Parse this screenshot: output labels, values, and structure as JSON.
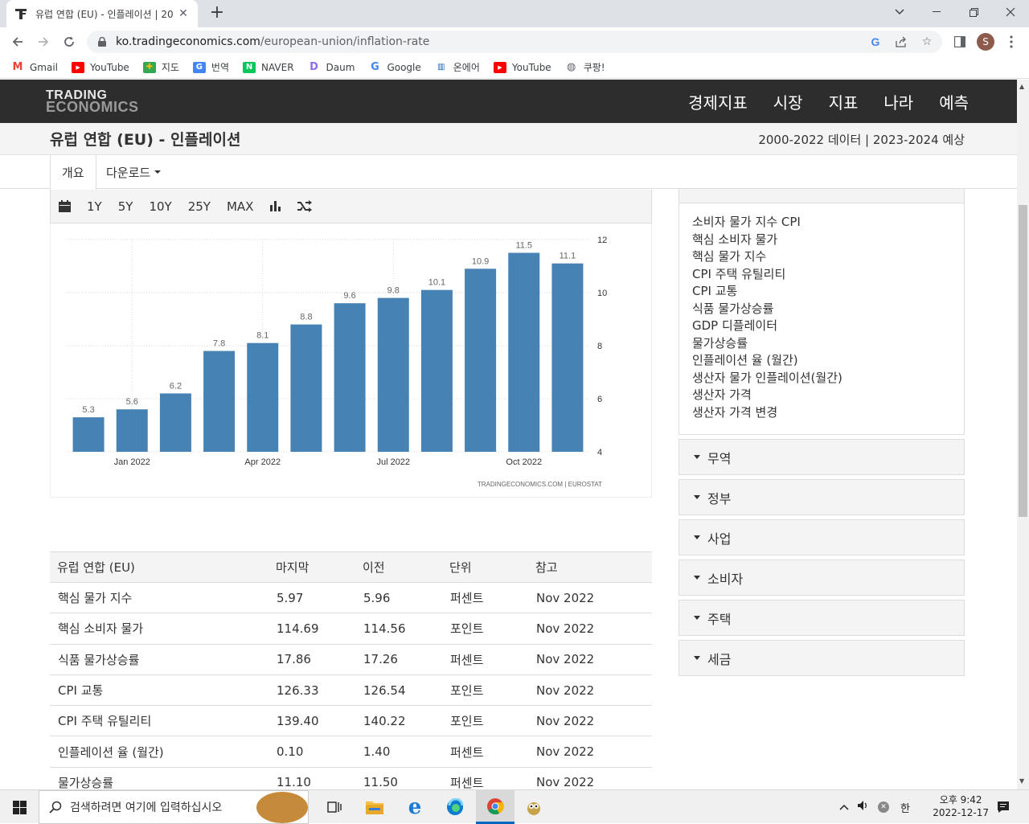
{
  "browser": {
    "tab_title": "유럽 연합 (EU) - 인플레이션 | 20",
    "url_host": "ko.tradingeconomics.com",
    "url_path": "/european-union/inflation-rate",
    "profile_initial": "S",
    "bookmarks": [
      "Gmail",
      "YouTube",
      "지도",
      "번역",
      "NAVER",
      "Daum",
      "Google",
      "온에어",
      "YouTube",
      "쿠팡!"
    ]
  },
  "site": {
    "logo_line1": "TRADING",
    "logo_line2": "ECONOMICS",
    "nav": [
      "경제지표",
      "시장",
      "지표",
      "나라",
      "예측"
    ],
    "page_title": "유럽 연합 (EU) - 인플레이션",
    "data_range": "2000-2022 데이터 | 2023-2024 예상",
    "tabs": {
      "overview": "개요",
      "download": "다운로드"
    }
  },
  "chart_toolbar": [
    "1Y",
    "5Y",
    "10Y",
    "25Y",
    "MAX"
  ],
  "chart_data": {
    "type": "bar",
    "categories": [
      "2021-12",
      "2022-01",
      "2022-02",
      "2022-03",
      "2022-04",
      "2022-05",
      "2022-06",
      "2022-07",
      "2022-08",
      "2022-09",
      "2022-10",
      "2022-11"
    ],
    "values": [
      5.3,
      5.6,
      6.2,
      7.8,
      8.1,
      8.8,
      9.6,
      9.8,
      10.1,
      10.9,
      11.5,
      11.1
    ],
    "x_tick_labels": [
      "Jan 2022",
      "Apr 2022",
      "Jul 2022",
      "Oct 2022"
    ],
    "y_ticks": [
      4,
      6,
      8,
      10,
      12
    ],
    "ylim": [
      4,
      12
    ],
    "source": "TRADINGECONOMICS.COM  |  EUROSTAT",
    "bar_color": "#4682b4",
    "grid": true,
    "y_axis_side": "right"
  },
  "table": {
    "headers": [
      "유럽 연합 (EU)",
      "마지막",
      "이전",
      "단위",
      "참고"
    ],
    "rows": [
      [
        "핵심 물가 지수",
        "5.97",
        "5.96",
        "퍼센트",
        "Nov 2022"
      ],
      [
        "핵심 소비자 물가",
        "114.69",
        "114.56",
        "포인트",
        "Nov 2022"
      ],
      [
        "식품 물가상승률",
        "17.86",
        "17.26",
        "퍼센트",
        "Nov 2022"
      ],
      [
        "CPI 교통",
        "126.33",
        "126.54",
        "포인트",
        "Nov 2022"
      ],
      [
        "CPI 주택 유틸리티",
        "139.40",
        "140.22",
        "포인트",
        "Nov 2022"
      ],
      [
        "인플레이션 율 (월간)",
        "0.10",
        "1.40",
        "퍼센트",
        "Nov 2022"
      ],
      [
        "물가상승률",
        "11.10",
        "11.50",
        "퍼센트",
        "Nov 2022"
      ]
    ]
  },
  "sidebar": {
    "links": [
      "소비자 물가 지수 CPI",
      "핵심 소비자 물가",
      "핵심 물가 지수",
      "CPI 주택 유틸리티",
      "CPI 교통",
      "식품 물가상승률",
      "GDP 디플레이터",
      "물가상승률",
      "인플레이션 율 (월간)",
      "생산자 물가 인플레이션(월간)",
      "생산자 가격",
      "생산자 가격 변경"
    ],
    "sections": [
      "무역",
      "정부",
      "사업",
      "소비자",
      "주택",
      "세금"
    ]
  },
  "taskbar": {
    "search_placeholder": "검색하려면 여기에 입력하십시오",
    "ime": "한",
    "time": "오후 9:42",
    "date": "2022-12-17"
  }
}
